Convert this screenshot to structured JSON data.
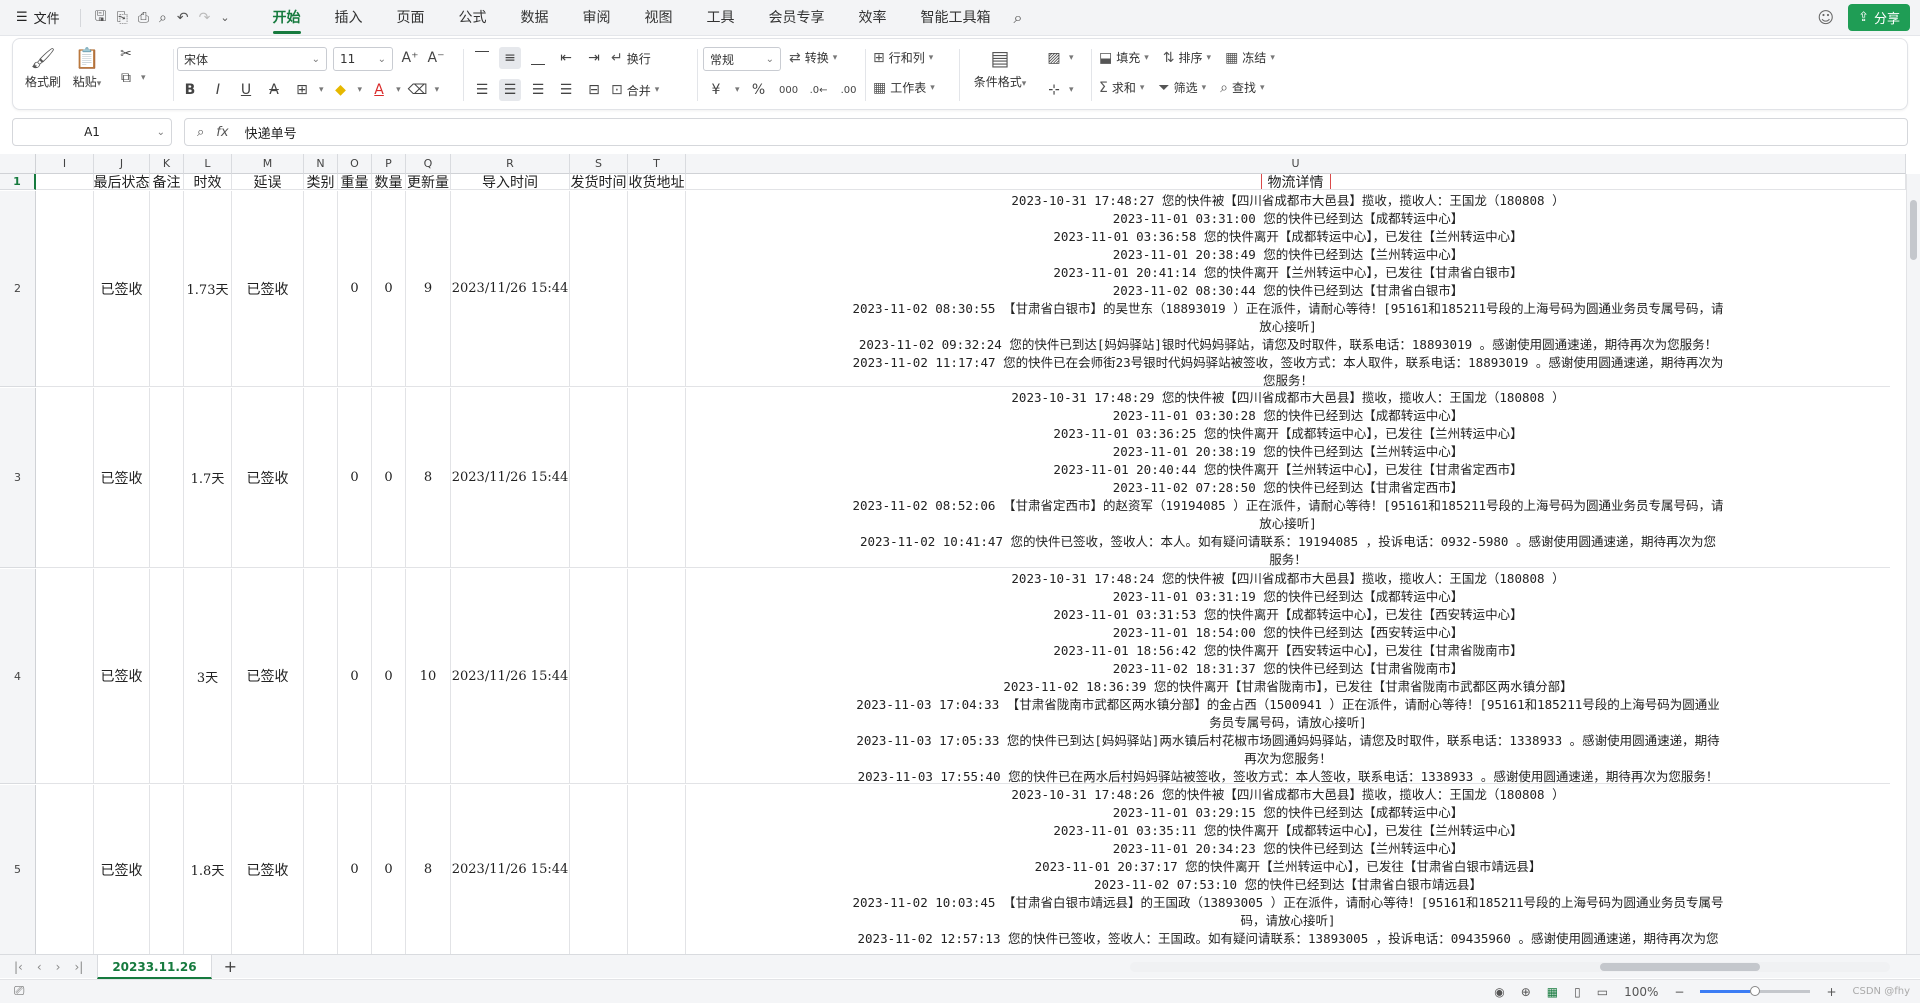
{
  "menubar": {
    "file_label": "文件",
    "tabs": [
      {
        "label": "开始",
        "active": true
      },
      {
        "label": "插入",
        "active": false
      },
      {
        "label": "页面",
        "active": false
      },
      {
        "label": "公式",
        "active": false
      },
      {
        "label": "数据",
        "active": false
      },
      {
        "label": "审阅",
        "active": false
      },
      {
        "label": "视图",
        "active": false
      },
      {
        "label": "工具",
        "active": false
      },
      {
        "label": "会员专享",
        "active": false
      },
      {
        "label": "效率",
        "active": false
      },
      {
        "label": "智能工具箱",
        "active": false
      }
    ],
    "share_label": "分享",
    "accent_color": "#167a3e"
  },
  "ribbon": {
    "format_painter": "格式刷",
    "paste": "粘贴",
    "font_name": "宋体",
    "font_size": "11",
    "wrap_text": "换行",
    "merge": "合并",
    "number_format": "常规",
    "convert": "转换",
    "rows_cols": "行和列",
    "worksheet": "工作表",
    "cond_format": "条件格式",
    "fill": "填充",
    "sort": "排序",
    "freeze": "冻结",
    "sum": "求和",
    "filter": "筛选",
    "find": "查找"
  },
  "formulabar": {
    "cell_ref": "A1",
    "value": "快递单号"
  },
  "columns": [
    {
      "letter": "I"
    },
    {
      "letter": "J"
    },
    {
      "letter": "K"
    },
    {
      "letter": "L"
    },
    {
      "letter": "M"
    },
    {
      "letter": "N"
    },
    {
      "letter": "O"
    },
    {
      "letter": "P"
    },
    {
      "letter": "Q"
    },
    {
      "letter": "R"
    },
    {
      "letter": "S"
    },
    {
      "letter": "T"
    },
    {
      "letter": "U"
    }
  ],
  "headers": {
    "I": "",
    "J": "最后状态",
    "K": "备注",
    "L": "时效",
    "M": "延误",
    "N": "类别",
    "O": "重量",
    "P": "数量",
    "Q": "更新量",
    "R": "导入时间",
    "S": "发货时间",
    "T": "收货地址",
    "U": "物流详情"
  },
  "rows": [
    {
      "num": "2",
      "J": "已签收",
      "K": "",
      "L": "1.73天",
      "M": "已签收",
      "N": "",
      "O": "0",
      "P": "0",
      "Q": "9",
      "R": "2023/11/26 15:44",
      "S": "",
      "T": "",
      "log": [
        "2023-10-31 17:48:27   您的快件被【四川省成都市大邑县】揽收，揽收人：王国龙（180808  ）",
        "2023-11-01 03:31:00   您的快件已经到达【成都转运中心】",
        "2023-11-01 03:36:58   您的快件离开【成都转运中心】，已发往【兰州转运中心】",
        "2023-11-01 20:38:49   您的快件已经到达【兰州转运中心】",
        "2023-11-01 20:41:14   您的快件离开【兰州转运中心】，已发往【甘肃省白银市】",
        "2023-11-02 08:30:44   您的快件已经到达【甘肃省白银市】",
        "2023-11-02 08:30:55   【甘肃省白银市】的吴世东（18893019   ）正在派件，请耐心等待！[95161和185211号段的上海号码为圆通业务员专属号码，请",
        "放心接听]",
        "2023-11-02 09:32:24   您的快件已到达[妈妈驿站]银时代妈妈驿站，请您及时取件，联系电话：18893019   。感谢使用圆通速递，期待再次为您服务！",
        "2023-11-02 11:17:47   您的快件已在会师街23号银时代妈妈驿站被签收，签收方式：本人取件，联系电话：18893019   。感谢使用圆通速递，期待再次为",
        "您服务！"
      ]
    },
    {
      "num": "3",
      "J": "已签收",
      "K": "",
      "L": "1.7天",
      "M": "已签收",
      "N": "",
      "O": "0",
      "P": "0",
      "Q": "8",
      "R": "2023/11/26 15:44",
      "S": "",
      "T": "",
      "log": [
        "2023-10-31 17:48:29   您的快件被【四川省成都市大邑县】揽收，揽收人：王国龙（180808  ）",
        "2023-11-01 03:30:28   您的快件已经到达【成都转运中心】",
        "2023-11-01 03:36:25   您的快件离开【成都转运中心】，已发往【兰州转运中心】",
        "2023-11-01 20:38:19   您的快件已经到达【兰州转运中心】",
        "2023-11-01 20:40:44   您的快件离开【兰州转运中心】，已发往【甘肃省定西市】",
        "2023-11-02 07:28:50   您的快件已经到达【甘肃省定西市】",
        "2023-11-02 08:52:06   【甘肃省定西市】的赵资军（19194085   ）正在派件，请耐心等待！[95161和185211号段的上海号码为圆通业务员专属号码，请",
        "放心接听]",
        "2023-11-02 10:41:47   您的快件已签收，签收人：本人。如有疑问请联系：19194085   ，投诉电话：0932-5980   。感谢使用圆通速递，期待再次为您",
        "服务！"
      ]
    },
    {
      "num": "4",
      "J": "已签收",
      "K": "",
      "L": "3天",
      "M": "已签收",
      "N": "",
      "O": "0",
      "P": "0",
      "Q": "10",
      "R": "2023/11/26 15:44",
      "S": "",
      "T": "",
      "log": [
        "2023-10-31 17:48:24   您的快件被【四川省成都市大邑县】揽收，揽收人：王国龙（180808  ）",
        "2023-11-01 03:31:19   您的快件已经到达【成都转运中心】",
        "2023-11-01 03:31:53   您的快件离开【成都转运中心】，已发往【西安转运中心】",
        "2023-11-01 18:54:00   您的快件已经到达【西安转运中心】",
        "2023-11-01 18:56:42   您的快件离开【西安转运中心】，已发往【甘肃省陇南市】",
        "2023-11-02 18:31:37   您的快件已经到达【甘肃省陇南市】",
        "2023-11-02 18:36:39   您的快件离开【甘肃省陇南市】，已发往【甘肃省陇南市武都区两水镇分部】",
        "2023-11-03 17:04:33   【甘肃省陇南市武都区两水镇分部】的金占西（1500941   ）正在派件，请耐心等待！[95161和185211号段的上海号码为圆通业",
        "务员专属号码，请放心接听]",
        "2023-11-03 17:05:33   您的快件已到达[妈妈驿站]两水镇后村花椒市场圆通妈妈驿站，请您及时取件，联系电话：1338933   。感谢使用圆通速递，期待",
        "再次为您服务！",
        "2023-11-03 17:55:40   您的快件已在两水后村妈妈驿站被签收，签收方式：本人签收，联系电话：1338933   。感谢使用圆通速递，期待再次为您服务！"
      ]
    },
    {
      "num": "5",
      "J": "已签收",
      "K": "",
      "L": "1.8天",
      "M": "已签收",
      "N": "",
      "O": "0",
      "P": "0",
      "Q": "8",
      "R": "2023/11/26 15:44",
      "S": "",
      "T": "",
      "log": [
        "2023-10-31 17:48:26   您的快件被【四川省成都市大邑县】揽收，揽收人：王国龙（180808  ）",
        "2023-11-01 03:29:15   您的快件已经到达【成都转运中心】",
        "2023-11-01 03:35:11   您的快件离开【成都转运中心】，已发往【兰州转运中心】",
        "2023-11-01 20:34:23   您的快件已经到达【兰州转运中心】",
        "2023-11-01 20:37:17   您的快件离开【兰州转运中心】，已发往【甘肃省白银市靖远县】",
        "2023-11-02 07:53:10   您的快件已经到达【甘肃省白银市靖远县】",
        "2023-11-02 10:03:45   【甘肃省白银市靖远县】的王国政（13893005   ）正在派件，请耐心等待！[95161和185211号段的上海号码为圆通业务员专属号",
        "码，请放心接听]",
        "2023-11-02 12:57:13   您的快件已签收，签收人：王国政。如有疑问请联系：13893005   ，投诉电话：09435960   。感谢使用圆通速递，期待再次为您"
      ]
    }
  ],
  "sheet": {
    "tab_name": "20233.11.26"
  },
  "statusbar": {
    "zoom": "100%",
    "watermark": "CSDN @fhy"
  }
}
